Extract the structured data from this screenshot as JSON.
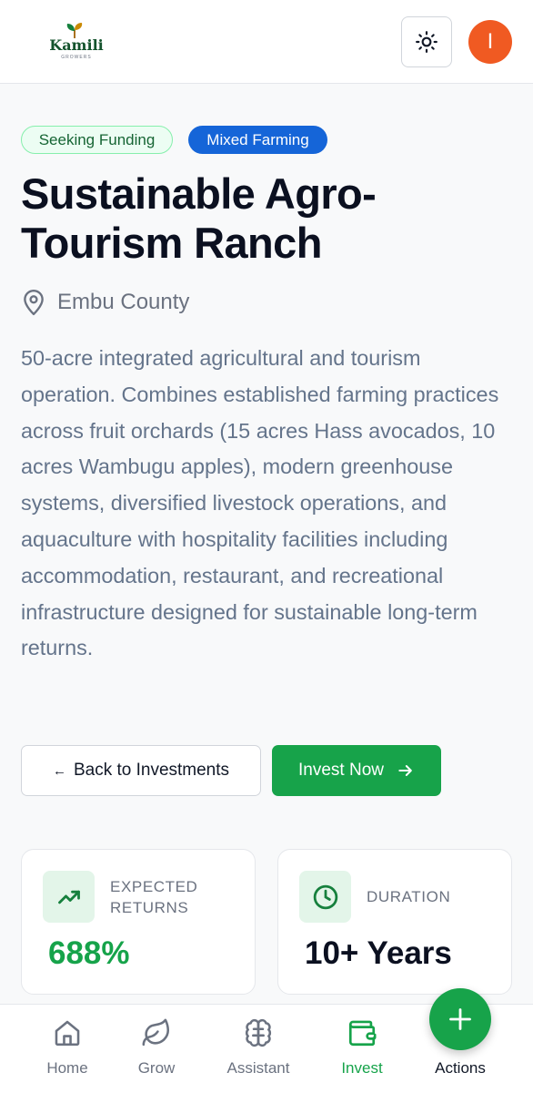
{
  "header": {
    "logo_name": "Kamili",
    "logo_sub": "GROWERS",
    "theme_icon": "sun-icon",
    "avatar_initial": "I"
  },
  "project": {
    "status_badge": "Seeking Funding",
    "type_badge": "Mixed Farming",
    "title": "Sustainable Agro-Tourism Ranch",
    "location": "Embu County",
    "description": "50-acre integrated agricultural and tourism operation. Combines established farming practices across fruit orchards (15 acres Hass avocados, 10 acres Wambugu apples), modern greenhouse systems, diversified livestock operations, and aquaculture with hospitality facilities including accommodation, restaurant, and recreational infrastructure designed for sustainable long-term returns."
  },
  "actions": {
    "back_arrow": "←",
    "back_label": "Back to Investments",
    "invest_label": "Invest Now"
  },
  "stats": {
    "returns_label": "EXPECTED RETURNS",
    "returns_value": "688%",
    "duration_label": "DURATION",
    "duration_value": "10+ Years"
  },
  "nav": {
    "items": [
      {
        "label": "Home",
        "icon": "home-icon"
      },
      {
        "label": "Grow",
        "icon": "leaf-icon"
      },
      {
        "label": "Assistant",
        "icon": "brain-icon"
      },
      {
        "label": "Invest",
        "icon": "wallet-icon",
        "active": true
      },
      {
        "label": "Actions",
        "icon": "plus-icon"
      }
    ]
  },
  "colors": {
    "accent_green": "#17a34a",
    "badge_blue": "#1565d8",
    "avatar_orange": "#f05a22"
  }
}
